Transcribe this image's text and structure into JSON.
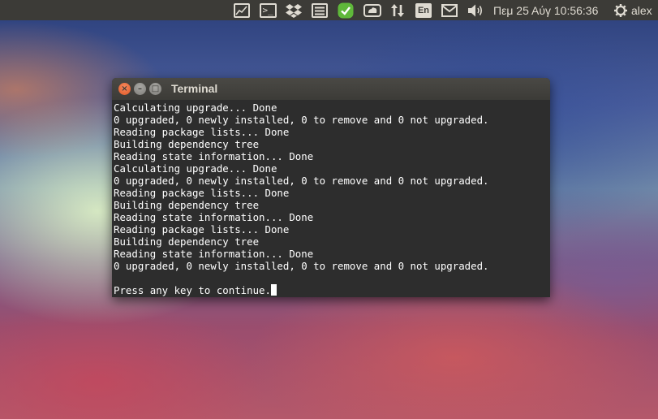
{
  "panel": {
    "indicators": [
      {
        "name": "system-monitor-icon"
      },
      {
        "name": "terminal-icon",
        "label": ">_"
      },
      {
        "name": "dropbox-icon"
      },
      {
        "name": "list-icon"
      },
      {
        "name": "checkmark-shield-icon"
      },
      {
        "name": "cloud-sync-icon"
      },
      {
        "name": "network-arrows-icon"
      },
      {
        "name": "keyboard-layout-icon",
        "label": "En"
      },
      {
        "name": "mail-icon"
      },
      {
        "name": "volume-icon"
      }
    ],
    "datetime": "Πεμ 25 Αύγ 10:56:36",
    "user": "alex",
    "accent": "#3c3b37"
  },
  "window": {
    "title": "Terminal",
    "close_color": "#e95420",
    "close_glyph": "×",
    "minimize_glyph": "–",
    "maximize_glyph": "□"
  },
  "terminal": {
    "lines": [
      "Calculating upgrade... Done",
      "0 upgraded, 0 newly installed, 0 to remove and 0 not upgraded.",
      "Reading package lists... Done",
      "Building dependency tree",
      "Reading state information... Done",
      "Calculating upgrade... Done",
      "0 upgraded, 0 newly installed, 0 to remove and 0 not upgraded.",
      "Reading package lists... Done",
      "Building dependency tree",
      "Reading state information... Done",
      "Reading package lists... Done",
      "Building dependency tree",
      "Reading state information... Done",
      "0 upgraded, 0 newly installed, 0 to remove and 0 not upgraded.",
      "",
      "Press any key to continue."
    ]
  }
}
